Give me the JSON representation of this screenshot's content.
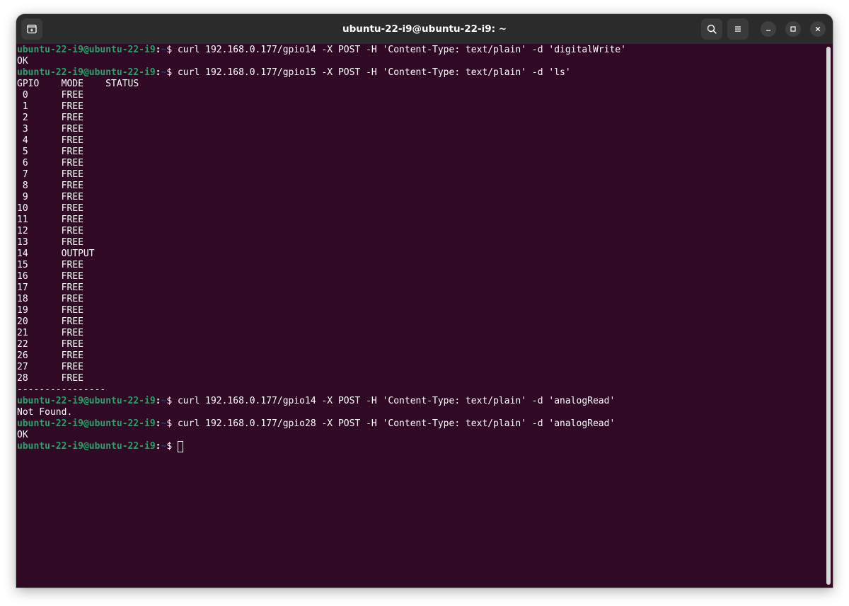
{
  "window": {
    "title": "ubuntu-22-i9@ubuntu-22-i9: ~"
  },
  "titlebar": {
    "icons": {
      "new_tab": "new-tab-icon",
      "search": "search-icon",
      "menu": "hamburger-menu-icon",
      "minimize": "minimize-icon",
      "maximize": "maximize-icon",
      "close": "close-icon"
    }
  },
  "colors": {
    "terminal_bg": "#300a24",
    "titlebar_bg": "#2b2b2b",
    "prompt_user": "#26a269",
    "prompt_path": "#12488b",
    "text": "#ffffff"
  },
  "prompt": {
    "user_host": "ubuntu-22-i9@ubuntu-22-i9",
    "sep": ":",
    "path": "~",
    "dollar": "$ "
  },
  "terminal": {
    "lines": [
      {
        "type": "cmd",
        "text": "curl 192.168.0.177/gpio14 -X POST -H 'Content-Type: text/plain' -d 'digitalWrite'"
      },
      {
        "type": "out",
        "text": "OK"
      },
      {
        "type": "cmd",
        "text": "curl 192.168.0.177/gpio15 -X POST -H 'Content-Type: text/plain' -d 'ls'"
      },
      {
        "type": "out",
        "text": "GPIO    MODE    STATUS"
      },
      {
        "type": "out",
        "text": " 0      FREE"
      },
      {
        "type": "out",
        "text": " 1      FREE"
      },
      {
        "type": "out",
        "text": " 2      FREE"
      },
      {
        "type": "out",
        "text": " 3      FREE"
      },
      {
        "type": "out",
        "text": " 4      FREE"
      },
      {
        "type": "out",
        "text": " 5      FREE"
      },
      {
        "type": "out",
        "text": " 6      FREE"
      },
      {
        "type": "out",
        "text": " 7      FREE"
      },
      {
        "type": "out",
        "text": " 8      FREE"
      },
      {
        "type": "out",
        "text": " 9      FREE"
      },
      {
        "type": "out",
        "text": "10      FREE"
      },
      {
        "type": "out",
        "text": "11      FREE"
      },
      {
        "type": "out",
        "text": "12      FREE"
      },
      {
        "type": "out",
        "text": "13      FREE"
      },
      {
        "type": "out",
        "text": "14      OUTPUT"
      },
      {
        "type": "out",
        "text": "15      FREE"
      },
      {
        "type": "out",
        "text": "16      FREE"
      },
      {
        "type": "out",
        "text": "17      FREE"
      },
      {
        "type": "out",
        "text": "18      FREE"
      },
      {
        "type": "out",
        "text": "19      FREE"
      },
      {
        "type": "out",
        "text": "20      FREE"
      },
      {
        "type": "out",
        "text": "21      FREE"
      },
      {
        "type": "out",
        "text": "22      FREE"
      },
      {
        "type": "out",
        "text": "26      FREE"
      },
      {
        "type": "out",
        "text": "27      FREE"
      },
      {
        "type": "out",
        "text": "28      FREE"
      },
      {
        "type": "out",
        "text": "----------------"
      },
      {
        "type": "cmd",
        "text": "curl 192.168.0.177/gpio14 -X POST -H 'Content-Type: text/plain' -d 'analogRead'"
      },
      {
        "type": "out",
        "text": "Not Found."
      },
      {
        "type": "cmd",
        "text": "curl 192.168.0.177/gpio28 -X POST -H 'Content-Type: text/plain' -d 'analogRead'"
      },
      {
        "type": "out",
        "text": "OK"
      },
      {
        "type": "active",
        "text": ""
      }
    ]
  }
}
